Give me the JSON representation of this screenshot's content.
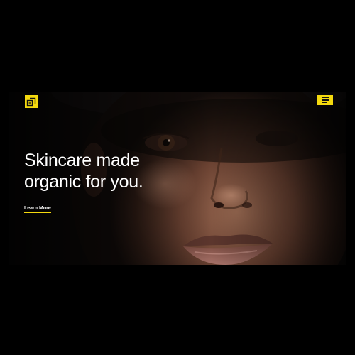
{
  "hero": {
    "headline_line1": "Skincare made",
    "headline_line2": "organic for you.",
    "cta_label": "Learn More",
    "image_alt": "Close-up portrait of a woman's face in soft low light"
  },
  "header": {
    "logo_icon": "brand-logo-icon",
    "menu_icon": "hamburger-menu-icon"
  },
  "colors": {
    "background": "#000000",
    "accent": "#f4d90e",
    "text": "#ffffff"
  }
}
